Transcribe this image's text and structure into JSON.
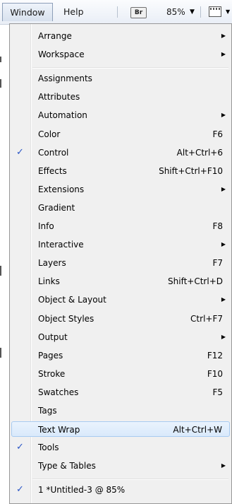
{
  "menubar": {
    "window_label": "Window",
    "help_label": "Help",
    "bridge_label": "Br",
    "zoom_value": "85%",
    "zoom_arrow": "▼",
    "view_arrow": "▼"
  },
  "menu": {
    "items": [
      {
        "label": "Arrange",
        "shortcut": "",
        "submenu": true,
        "checked": false
      },
      {
        "label": "Workspace",
        "shortcut": "",
        "submenu": true,
        "checked": false
      },
      {
        "label": "Assignments",
        "shortcut": "",
        "submenu": false,
        "checked": false
      },
      {
        "label": "Attributes",
        "shortcut": "",
        "submenu": false,
        "checked": false
      },
      {
        "label": "Automation",
        "shortcut": "",
        "submenu": true,
        "checked": false
      },
      {
        "label": "Color",
        "shortcut": "F6",
        "submenu": false,
        "checked": false
      },
      {
        "label": "Control",
        "shortcut": "Alt+Ctrl+6",
        "submenu": false,
        "checked": true
      },
      {
        "label": "Effects",
        "shortcut": "Shift+Ctrl+F10",
        "submenu": false,
        "checked": false
      },
      {
        "label": "Extensions",
        "shortcut": "",
        "submenu": true,
        "checked": false
      },
      {
        "label": "Gradient",
        "shortcut": "",
        "submenu": false,
        "checked": false
      },
      {
        "label": "Info",
        "shortcut": "F8",
        "submenu": false,
        "checked": false
      },
      {
        "label": "Interactive",
        "shortcut": "",
        "submenu": true,
        "checked": false
      },
      {
        "label": "Layers",
        "shortcut": "F7",
        "submenu": false,
        "checked": false
      },
      {
        "label": "Links",
        "shortcut": "Shift+Ctrl+D",
        "submenu": false,
        "checked": false
      },
      {
        "label": "Object & Layout",
        "shortcut": "",
        "submenu": true,
        "checked": false
      },
      {
        "label": "Object Styles",
        "shortcut": "Ctrl+F7",
        "submenu": false,
        "checked": false
      },
      {
        "label": "Output",
        "shortcut": "",
        "submenu": true,
        "checked": false
      },
      {
        "label": "Pages",
        "shortcut": "F12",
        "submenu": false,
        "checked": false
      },
      {
        "label": "Stroke",
        "shortcut": "F10",
        "submenu": false,
        "checked": false
      },
      {
        "label": "Swatches",
        "shortcut": "F5",
        "submenu": false,
        "checked": false
      },
      {
        "label": "Tags",
        "shortcut": "",
        "submenu": false,
        "checked": false
      },
      {
        "label": "Text Wrap",
        "shortcut": "Alt+Ctrl+W",
        "submenu": false,
        "checked": false,
        "highlighted": true
      },
      {
        "label": "Tools",
        "shortcut": "",
        "submenu": false,
        "checked": true
      },
      {
        "label": "Type & Tables",
        "shortcut": "",
        "submenu": true,
        "checked": false
      },
      {
        "label": "1 *Untitled-3 @ 85%",
        "shortcut": "",
        "submenu": false,
        "checked": true
      }
    ],
    "check_glyph": "✓",
    "submenu_glyph": "▶"
  },
  "colors": {
    "menu_bg": "#f0f0f0",
    "highlight_bg": "#d9e9fb",
    "highlight_border": "#a8cbf1",
    "check": "#2a56c6"
  }
}
